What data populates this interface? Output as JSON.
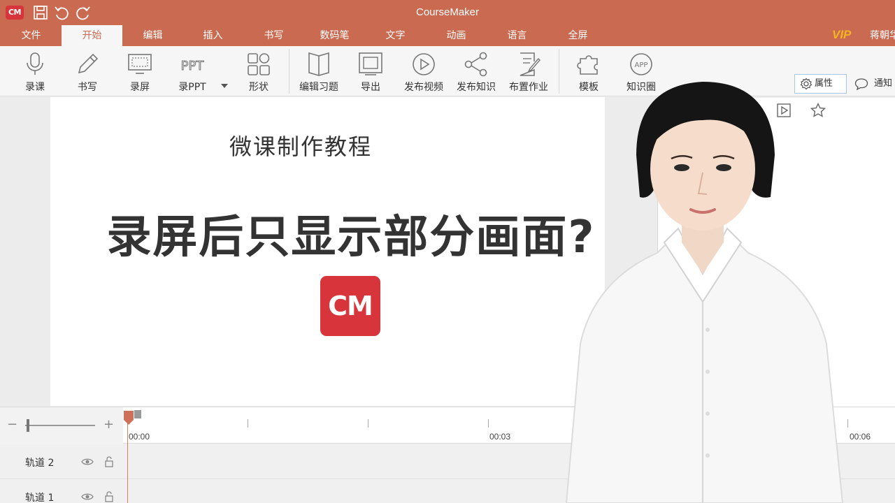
{
  "titlebar": {
    "logo_text": "CM",
    "title": "CourseMaker",
    "icons": [
      "save-icon",
      "undo-icon",
      "redo-icon"
    ]
  },
  "menu": {
    "items": [
      "文件",
      "开始",
      "编辑",
      "插入",
      "书写",
      "数码笔",
      "文字",
      "动画",
      "语言",
      "全屏"
    ],
    "active": "开始",
    "vip": "VIP",
    "user": "蒋朝华"
  },
  "ribbon": {
    "buttons": [
      {
        "label": "录课",
        "icon": "microphone-icon"
      },
      {
        "label": "书写",
        "icon": "pencil-icon"
      },
      {
        "label": "录屏",
        "icon": "screen-record-icon"
      },
      {
        "label": "录PPT",
        "icon": "ppt-icon"
      },
      {
        "label": "形状",
        "icon": "shapes-icon"
      },
      {
        "label": "编辑习题",
        "icon": "book-icon"
      },
      {
        "label": "导出",
        "icon": "export-icon"
      },
      {
        "label": "发布视频",
        "icon": "play-circle-icon"
      },
      {
        "label": "发布知识",
        "icon": "share-icon"
      },
      {
        "label": "布置作业",
        "icon": "assignment-icon"
      },
      {
        "label": "模板",
        "icon": "puzzle-icon"
      },
      {
        "label": "知识圈",
        "icon": "app-icon"
      }
    ],
    "properties_label": "属性",
    "notify_label": "通知"
  },
  "slide": {
    "subtitle": "微课制作教程",
    "title": "录屏后只显示部分画面?",
    "logo_text": "CM"
  },
  "timeline": {
    "time_labels": [
      "00:00",
      "00:03",
      "00:06"
    ],
    "tracks": [
      "轨道 2",
      "轨道 1"
    ]
  },
  "colors": {
    "brand": "#c96a51",
    "logo_red": "#d8343b",
    "vip": "#f4b321"
  }
}
